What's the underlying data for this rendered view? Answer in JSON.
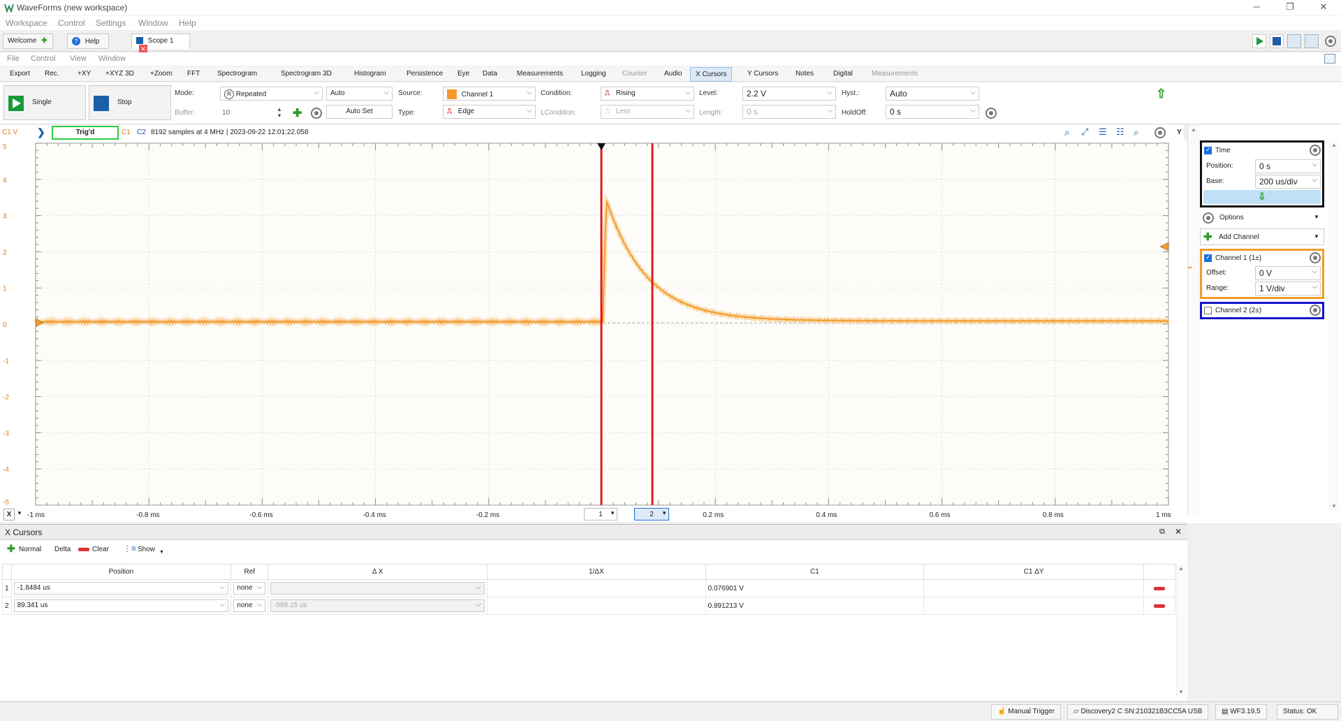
{
  "app": {
    "title": "WaveForms (new workspace)"
  },
  "main_menu": [
    "Workspace",
    "Control",
    "Settings",
    "Window",
    "Help"
  ],
  "tabs": {
    "welcome": "Welcome",
    "help": "Help",
    "scope": "Scope 1"
  },
  "instrument_menu": [
    "File",
    "Control",
    "View",
    "Window"
  ],
  "toolbar": {
    "items": [
      "Export",
      "Rec.",
      "+XY",
      "+XYZ 3D",
      "+Zoom",
      "FFT",
      "Spectrogram",
      "Spectrogram 3D",
      "Histogram",
      "Persistence",
      "Eye",
      "Data",
      "Measurements",
      "Logging",
      "Counter",
      "Audio",
      "X Cursors",
      "Y Cursors",
      "Notes",
      "Digital",
      "Measurements"
    ]
  },
  "controls": {
    "single": "Single",
    "stop": "Stop",
    "mode_label": "Mode:",
    "mode_value": "Repeated",
    "auto_value": "Auto",
    "buffer_label": "Buffer:",
    "buffer_value": "10",
    "autoset": "Auto Set",
    "source_label": "Source:",
    "source_value": "Channel 1",
    "type_label": "Type:",
    "type_value": "Edge",
    "condition_label": "Condition:",
    "condition_value": "Rising",
    "lcondition_label": "LCondition:",
    "lcondition_value": "Less",
    "level_label": "Level:",
    "level_value": "2.2 V",
    "length_label": "Length:",
    "length_value": "0 s",
    "hyst_label": "Hyst.:",
    "hyst_value": "Auto",
    "holdoff_label": "HoldOff:",
    "holdoff_value": "0 s"
  },
  "status": {
    "unit": "C1 V",
    "trig": "Trig'd",
    "c1": "C1",
    "c2": "C2",
    "info": "8192 samples at 4 MHz | 2023-09-22 12:01:22.058",
    "y_btn": "Y"
  },
  "plot": {
    "x_labels": [
      "-1 ms",
      "-0.8 ms",
      "-0.6 ms",
      "-0.4 ms",
      "-0.2 ms",
      "0.2 ms",
      "0.4 ms",
      "0.6 ms",
      "0.8 ms",
      "1 ms"
    ],
    "y_labels": [
      "5",
      "4",
      "3",
      "2",
      "1",
      "0",
      "-1",
      "-2",
      "-3",
      "-4",
      "-5"
    ],
    "x_axis_btn": "X",
    "cursor1_label": "1",
    "cursor2_label": "2",
    "trace_color": "#f39a2a",
    "cursor_color": "#e01b1b"
  },
  "right_panel": {
    "time_title": "Time",
    "position_label": "Position:",
    "position_value": "0 s",
    "base_label": "Base:",
    "base_value": "200 us/div",
    "options": "Options",
    "add_channel": "Add Channel",
    "ch1_title": "Channel 1 (1±)",
    "offset_label": "Offset:",
    "offset_value": "0 V",
    "range_label": "Range:",
    "range_value": "1 V/div",
    "ch2_title": "Channel 2 (2±)"
  },
  "cursors_panel": {
    "title": "X Cursors",
    "tools": {
      "normal": "Normal",
      "delta": "Delta",
      "clear": "Clear",
      "show": "Show"
    },
    "columns": [
      "Position",
      "Ref",
      "Δ X",
      "1/ΔX",
      "C1",
      "C1 ΔY"
    ],
    "rows": [
      {
        "idx": "1",
        "position": "-1.8484 us",
        "ref": "none",
        "dx": "",
        "inv": "",
        "c1": "0.076901 V",
        "c1dy": ""
      },
      {
        "idx": "2",
        "position": "89.341 us",
        "ref": "none",
        "dx": "-598.15 us",
        "inv": "",
        "c1": "0.891213 V",
        "c1dy": ""
      }
    ]
  },
  "bottom": {
    "manual_trigger": "Manual Trigger",
    "device": "Discovery2 C SN:210321B3CC5A USB",
    "version": "WF3.19.5",
    "status": "Status: OK"
  }
}
